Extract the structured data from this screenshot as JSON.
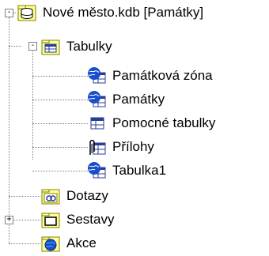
{
  "tree": {
    "root": {
      "label": "Nové město.kdb [Památky]",
      "icon": "database-icon",
      "expanded": true
    },
    "tabulky": {
      "label": "Tabulky",
      "icon": "table-folder-icon",
      "expanded": true,
      "children": [
        {
          "label": "Památková zóna",
          "icon": "globe-table-icon"
        },
        {
          "label": "Památky",
          "icon": "globe-table-icon"
        },
        {
          "label": "Pomocné tabulky",
          "icon": "table-icon"
        },
        {
          "label": "Přílohy",
          "icon": "attachment-table-icon"
        },
        {
          "label": "Tabulka1",
          "icon": "globe-table-icon"
        }
      ]
    },
    "dotazy": {
      "label": "Dotazy",
      "icon": "query-icon"
    },
    "sestavy": {
      "label": "Sestavy",
      "icon": "report-folder-icon",
      "expanded": false
    },
    "akce": {
      "label": "Akce",
      "icon": "action-globe-icon"
    }
  },
  "colors": {
    "folder": "#ffff99",
    "folder_border": "#808000",
    "globe_blue": "#1a4ecc",
    "table_blue": "#2a3c9a"
  }
}
